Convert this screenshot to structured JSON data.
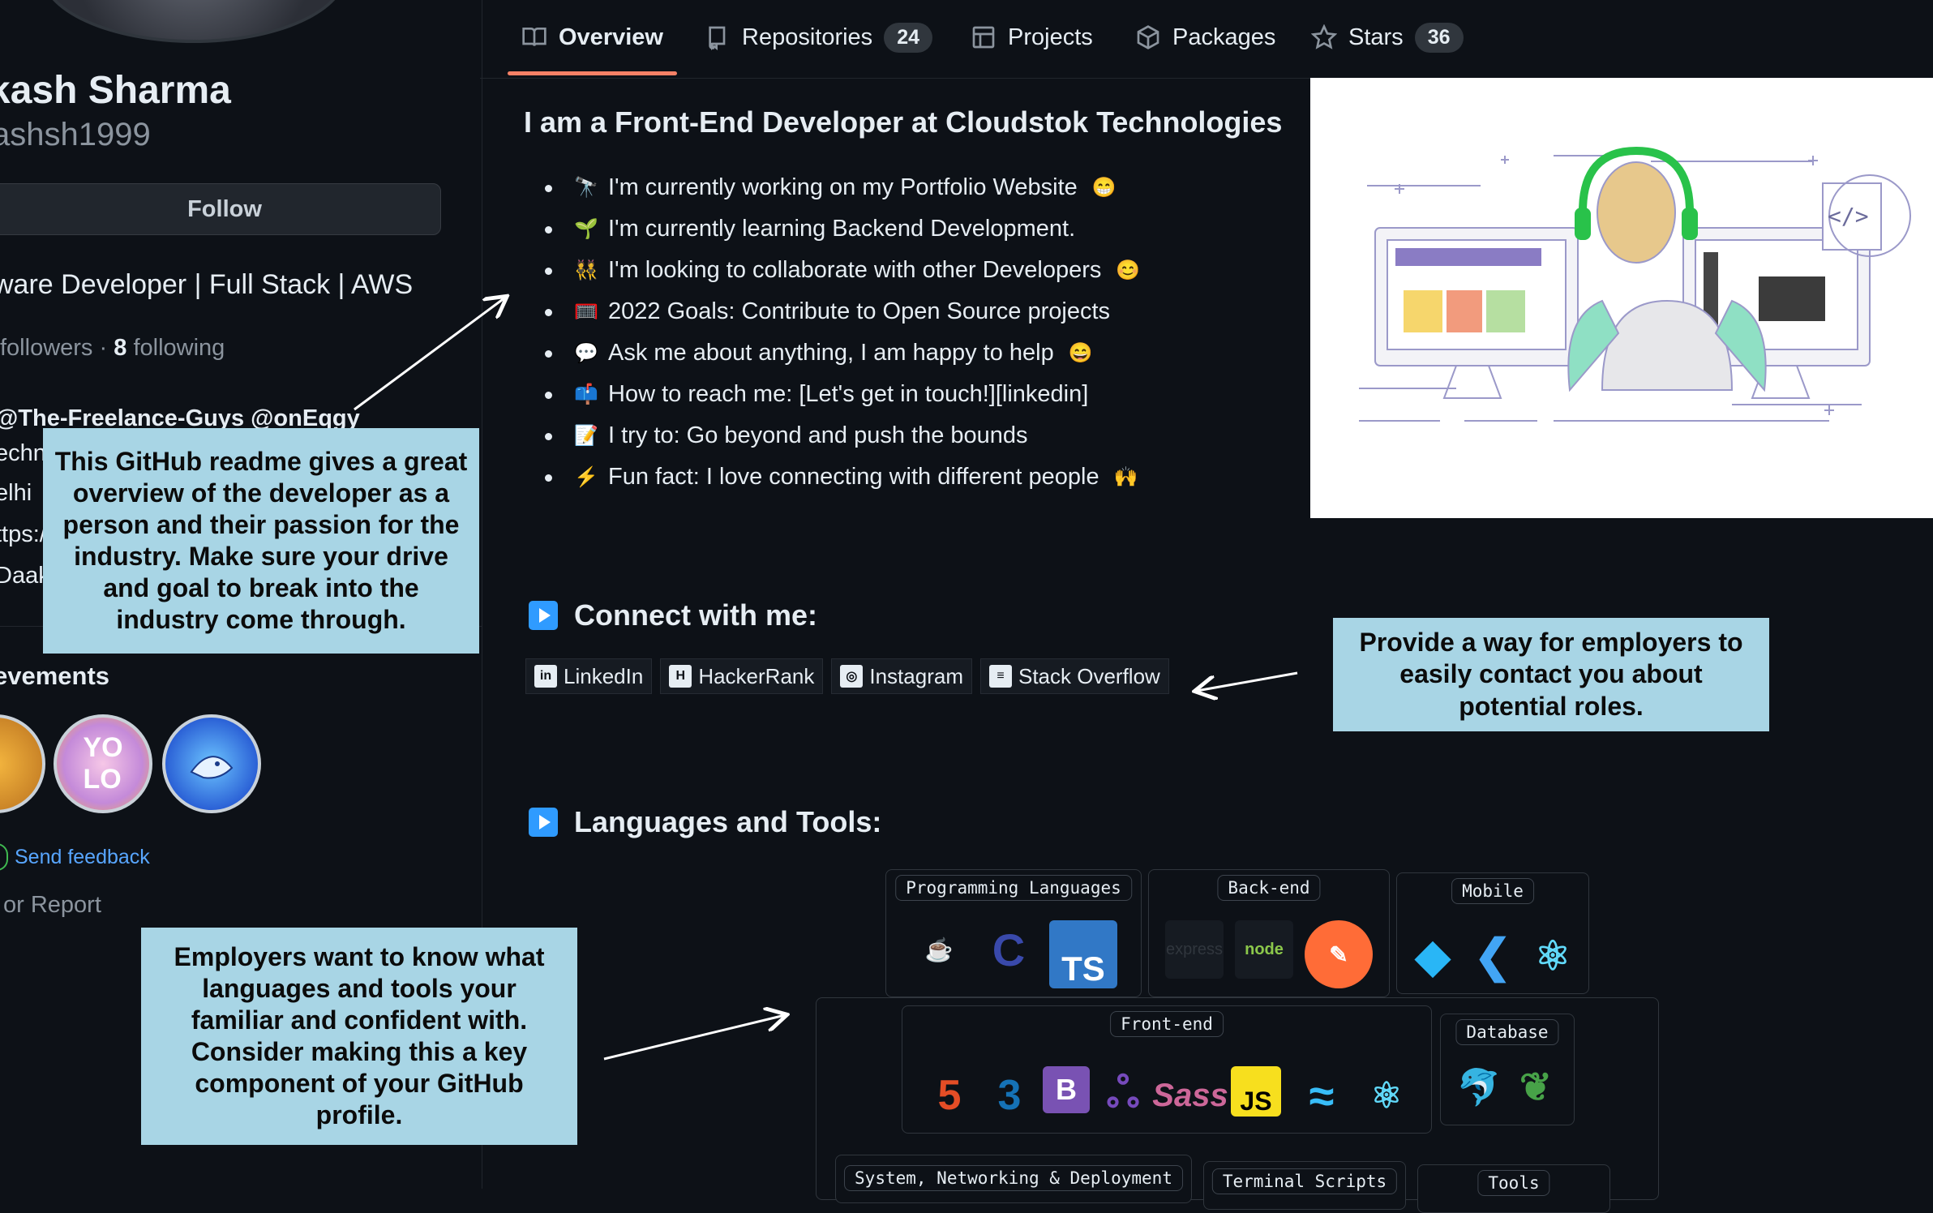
{
  "nav": {
    "tabs": [
      {
        "label": "Overview",
        "icon": "book-icon"
      },
      {
        "label": "Repositories",
        "count": "24",
        "icon": "repo-icon"
      },
      {
        "label": "Projects",
        "icon": "table-icon"
      },
      {
        "label": "Packages",
        "icon": "package-icon"
      },
      {
        "label": "Stars",
        "count": "36",
        "icon": "star-icon"
      }
    ]
  },
  "profile": {
    "name": "kash Sharma",
    "login": "ashsh1999",
    "follow_label": "Follow",
    "bio": "ware Developer | Full Stack | AWS",
    "followers_label": "followers",
    "following_count": "8",
    "following_label": "following",
    "separator": "·",
    "org": "@The-Freelance-Guys @onEqgy",
    "company": "echn",
    "location": "elhi",
    "website": "ttps:/",
    "twitter": "Daak",
    "achievements_title": "evements",
    "send_feedback": "Send feedback",
    "report": "or Report"
  },
  "readme": {
    "title": "I am a Front-End Developer at Cloudstok Technologies",
    "bullets": [
      {
        "icon": "🔭",
        "text": "I'm currently working on my Portfolio Website",
        "end": "😁"
      },
      {
        "icon": "🌱",
        "text": "I'm currently learning Backend Development.",
        "end": ""
      },
      {
        "icon": "👯",
        "text": "I'm looking to collaborate with other Developers",
        "end": "😊"
      },
      {
        "icon": "🥅",
        "text": "2022 Goals: Contribute to Open Source projects",
        "end": ""
      },
      {
        "icon": "💬",
        "text": "Ask me about anything, I am happy to help",
        "end": "😄"
      },
      {
        "icon": "📫",
        "text": "How to reach me: [Let's get in touch!][linkedin]",
        "end": ""
      },
      {
        "icon": "📝",
        "text": "I try to: Go beyond and push the bounds",
        "end": ""
      },
      {
        "icon": "⚡",
        "text": "Fun fact: I love connecting with different people",
        "end": "🙌"
      }
    ],
    "connect_title": "Connect with me:",
    "connect": [
      {
        "label": "LinkedIn",
        "glyph": "in"
      },
      {
        "label": "HackerRank",
        "glyph": "H"
      },
      {
        "label": "Instagram",
        "glyph": "◎"
      },
      {
        "label": "Stack Overflow",
        "glyph": "≡"
      }
    ],
    "tools_title": "Languages and Tools:",
    "tool_groups": {
      "programming": {
        "label": "Programming Languages",
        "icons": [
          "Java",
          "C",
          "TS"
        ]
      },
      "backend": {
        "label": "Back-end",
        "icons": [
          "express",
          "node",
          "postman"
        ]
      },
      "mobile": {
        "label": "Mobile",
        "icons": [
          "Dart",
          "Flutter",
          "React Native"
        ]
      },
      "frontend": {
        "label": "Front-end",
        "icons": [
          "HTML5",
          "CSS3",
          "Bootstrap",
          "Redux",
          "Sass",
          "JS",
          "Tailwind",
          "React"
        ]
      },
      "database": {
        "label": "Database",
        "icons": [
          "MySQL",
          "MongoDB"
        ]
      },
      "system": {
        "label": "System, Networking & Deployment"
      },
      "terminal": {
        "label": "Terminal Scripts"
      },
      "tools": {
        "label": "Tools"
      }
    }
  },
  "callouts": {
    "readme": "This GitHub readme gives a great overview of the developer as a person and their passion for the industry. Make sure your drive and goal to break into the industry come through.",
    "contact": "Provide a way for employers to easily contact you about potential roles.",
    "tools": "Employers want to know what languages and tools your familiar and confident with. Consider making this a key component of your GitHub profile."
  },
  "colors": {
    "background": "#0d1117",
    "accent_underline": "#f78166",
    "callout_bg": "#a8d5e5",
    "link": "#58a6ff"
  }
}
